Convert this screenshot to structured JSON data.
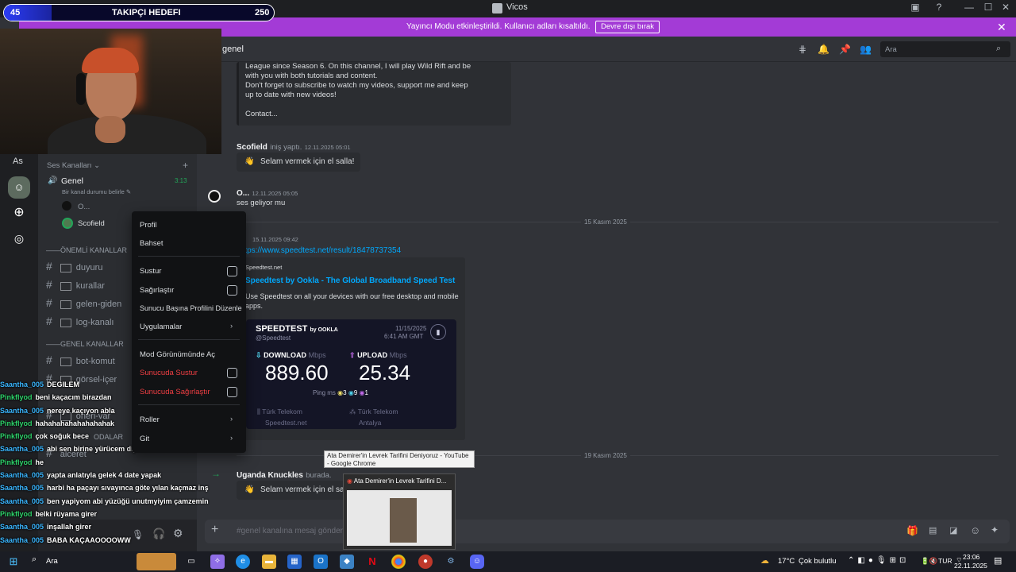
{
  "window": {
    "title": "Vicos"
  },
  "goal": {
    "current": "45",
    "label": "TAKIPÇI HEDEFI",
    "target": "250"
  },
  "banner": {
    "message": "Yayıncı Modu etkinleştirildi. Kullanıcı adları kısaltıldı.",
    "button": "Devre dışı bırak"
  },
  "rail": {
    "initials": "As"
  },
  "sidebar": {
    "voice_header": "Ses Kanalları",
    "voice_channel": "Genel",
    "voice_time": "3:13",
    "voice_status": "Bir kanal durumu belirle",
    "voice_users": [
      "O...",
      "Scofield"
    ],
    "cat_important": "ÖNEMLİ KANALLAR",
    "important": [
      "duyuru",
      "kurallar",
      "gelen-giden",
      "log-kanalı"
    ],
    "cat_general": "GENEL KANALLAR",
    "general": [
      "bot-komut",
      "görsel-içer",
      "oneri-var",
      "ODALAR",
      "alceret"
    ]
  },
  "context_menu": {
    "items": [
      "Profil",
      "Bahset",
      "Sustur",
      "Sağırlaştır",
      "Sunucu Başına Profilini Düzenle",
      "Uygulamalar",
      "Mod Görünümünde Aç",
      "Sunucuda Sustur",
      "Sunucuda Sağırlaştır",
      "Roller",
      "Git"
    ]
  },
  "header": {
    "channel": "genel",
    "search_placeholder": "Ara"
  },
  "messages": {
    "embed_lines": [
      "League since Season 6. On this channel, I will play Wild Rift and be",
      "with you with both tutorials and content.",
      "Don't forget to subscribe to watch my videos, support me and keep",
      "up to date with new videos!",
      "Contact..."
    ],
    "join1_user": "Scofield",
    "join1_text": "iniş yaptı.",
    "join1_time": "12.11.2025 05:01",
    "wave": "Selam vermek için el salla!",
    "msg_user": "O...",
    "msg_time": "12.11.2025 05:05",
    "msg_text": "ses geliyor mu",
    "day1": "15 Kasım 2025",
    "link_time": "15.11.2025 09:42",
    "link": "https://www.speedtest.net/result/18478737354",
    "embed_site": "Speedtest.net",
    "embed_title": "Speedtest by Ookla - The Global Broadband Speed Test",
    "embed_desc1": "Use Speedtest on all your devices with our free desktop and mobile",
    "embed_desc2": "apps.",
    "day2": "19 Kasım 2025",
    "join2_user": "Uganda Knuckles",
    "join2_text": "burada.",
    "wave2": "Selam vermek için el sa"
  },
  "speedtest": {
    "brand": "SPEEDTEST",
    "by": "by OOKLA",
    "handle": "@Speedtest",
    "date": "11/15/2025",
    "time": "6:41 AM GMT",
    "dl_label": "DOWNLOAD",
    "dl_unit": "Mbps",
    "dl_value": "889.60",
    "ul_label": "UPLOAD",
    "ul_unit": "Mbps",
    "ul_value": "25.34",
    "ping_label": "Ping",
    "ping_unit": "ms",
    "ping_vals": [
      "3",
      "9",
      "1"
    ],
    "isp1": "Türk Telekom",
    "isp2": "Türk Telekom",
    "site": "Speedtest.net",
    "city": "Antalya"
  },
  "composer": {
    "placeholder": "#genel kanalına mesaj gönder"
  },
  "chat": [
    {
      "user": "Saantha_005",
      "text": "DEGILEM"
    },
    {
      "user": "Pinkflyod",
      "text": "beni kaçacım birazdan"
    },
    {
      "user": "Saantha_005",
      "text": "nereye kaçıyon abla"
    },
    {
      "user": "Pinkflyod",
      "text": "hahahahahahahahahak"
    },
    {
      "user": "Pinkflyod",
      "text": "çok soğuk bece"
    },
    {
      "user": "Saantha_005",
      "text": "abi sen birine yürücem diyodun ne oldu amk"
    },
    {
      "user": "Pinkflyod",
      "text": "he"
    },
    {
      "user": "Saantha_005",
      "text": "yapta anlatıyla gelek 4 date yapak"
    },
    {
      "user": "Saantha_005",
      "text": "harbi ha paçayı sıvayınca göte yılan kaçmaz inş"
    },
    {
      "user": "Saantha_005",
      "text": "ben yapiyom abi yüzüğü unutmyiyim çamzemin"
    },
    {
      "user": "Pinkflyod",
      "text": "belki rüyama girer"
    },
    {
      "user": "Saantha_005",
      "text": "inşallah girer"
    },
    {
      "user": "Saantha_005",
      "text": "BABA KAÇAAOOOOWW"
    }
  ],
  "tooltip": {
    "text": "Ata Demirer'in Levrek Tarifini Deniyoruz - YouTube - Google Chrome"
  },
  "preview": {
    "title": "Ata Demirer'in Levrek Tarifini D..."
  },
  "taskbar": {
    "search": "Ara",
    "temp": "17°C",
    "weather": "Çok bulutlu",
    "lang": "TUR",
    "time": "23:06",
    "date": "22.11.2025"
  }
}
